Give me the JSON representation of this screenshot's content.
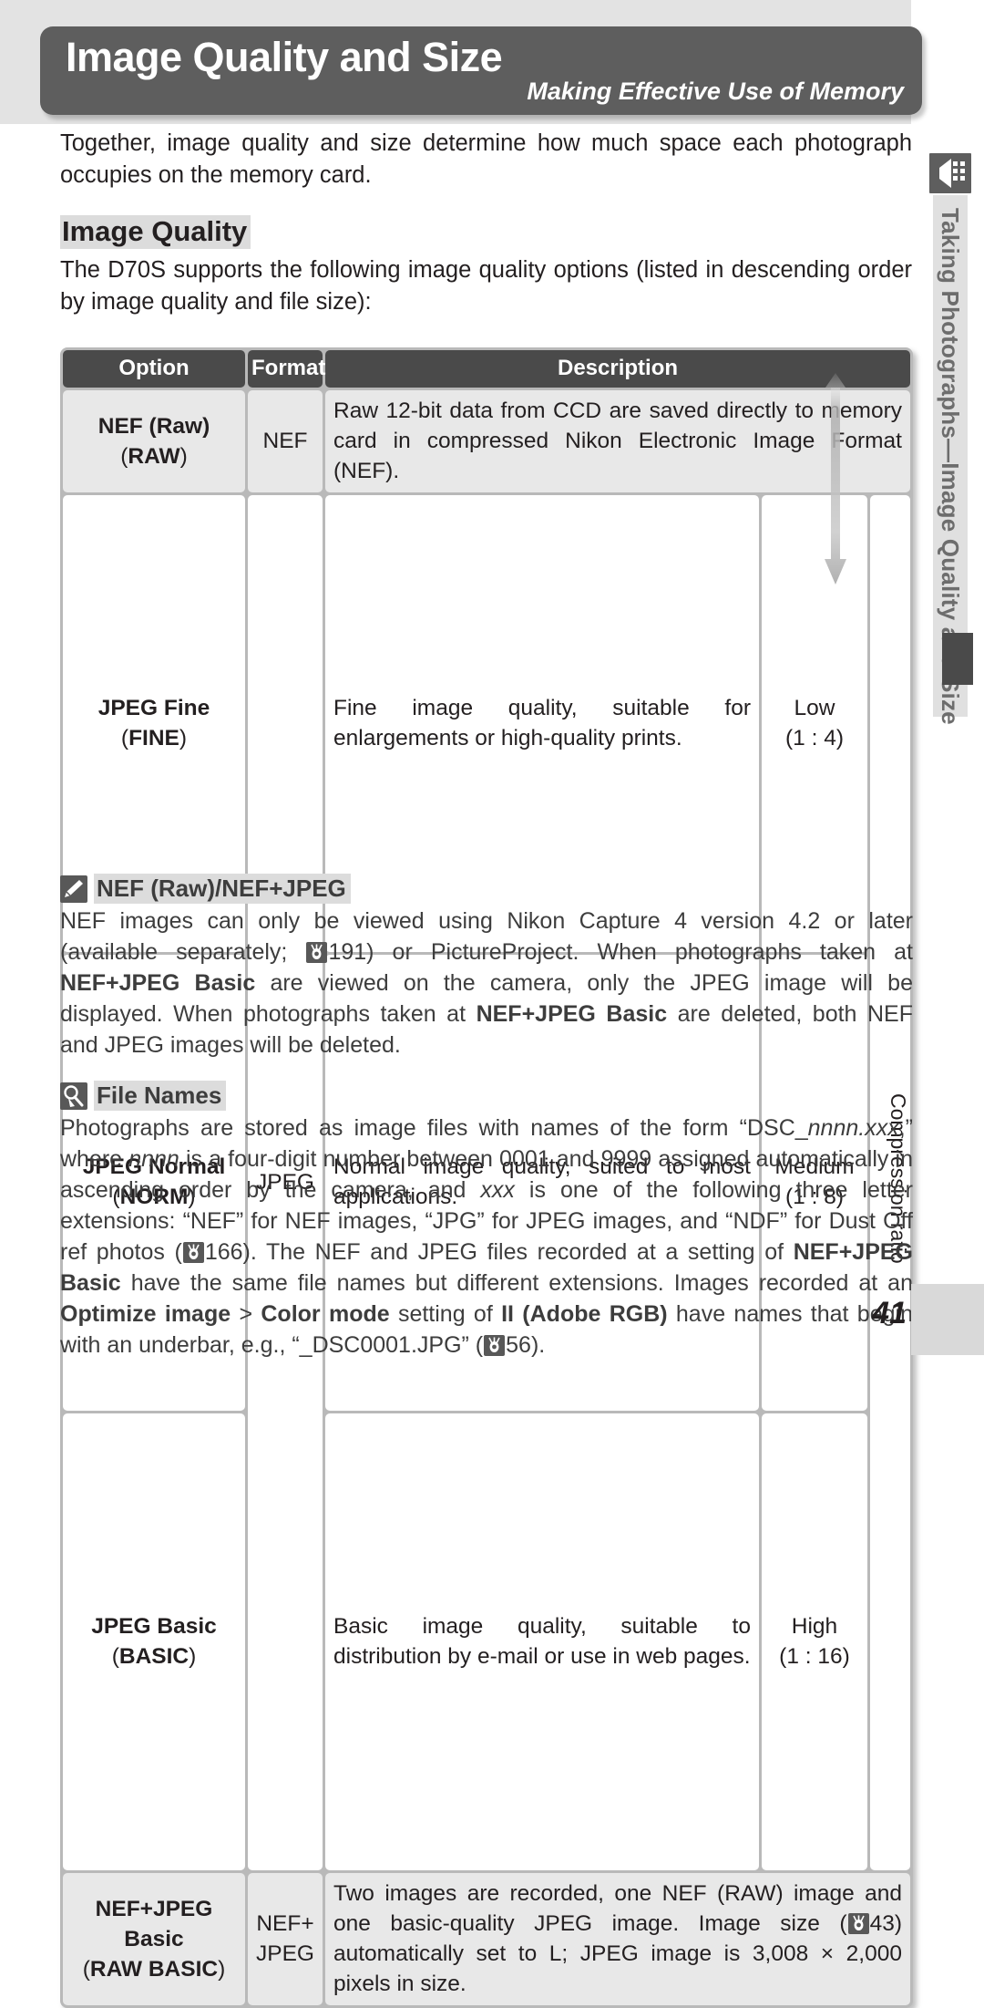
{
  "header": {
    "title": "Image Quality and Size",
    "subtitle": "Making Effective Use of Memory",
    "bg_color": "#5e5e5e"
  },
  "intro": {
    "paragraph": "Together, image quality and size determine how much space each photograph occupies on the memory card."
  },
  "section": {
    "heading": "Image Quality",
    "paragraph": "The D70S supports the following image quality options (listed in descending order by image quality and file size):"
  },
  "table": {
    "headers": {
      "option": "Option",
      "format": "Format",
      "description": "Description"
    },
    "compression_label": "Compression ratio",
    "rows": [
      {
        "option": "NEF (Raw)",
        "option_code": "(RAW)",
        "format": "NEF",
        "description": "Raw 12-bit data from CCD are saved directly to memory card in compressed Nikon Electronic Image Format (NEF).",
        "ratio": "",
        "ratio_value": ""
      },
      {
        "option": "JPEG Fine",
        "option_code": "(FINE)",
        "format": "JPEG",
        "description": "Fine image quality, suitable for enlargements or high-quality prints.",
        "ratio": "Low",
        "ratio_value": "(1 : 4)"
      },
      {
        "option": "JPEG Normal",
        "option_code": "(NORM)",
        "format": "",
        "description": "Normal image quality, suited to most applications.",
        "ratio": "Medium",
        "ratio_value": "(1 : 8)"
      },
      {
        "option": "JPEG Basic",
        "option_code": "(BASIC)",
        "format": "",
        "description": "Basic image quality, suitable to distribution by e-mail or use in web pages.",
        "ratio": "High",
        "ratio_value": "(1 : 16)"
      },
      {
        "option": "NEF+JPEG Basic",
        "option_code": "(RAW BASIC)",
        "format": "NEF+ JPEG",
        "description_pre": "Two images are recorded, one NEF (RAW) image and one basic-quality JPEG image.  Image size (",
        "description_page_ref": "43",
        "description_post": ") automatically set to L; JPEG image is 3,008 × 2,000 pixels in size.",
        "ratio": "",
        "ratio_value": ""
      }
    ]
  },
  "notes": [
    {
      "icon": "pencil-icon",
      "title": "NEF (Raw)/NEF+JPEG",
      "body_1": "NEF images can only be viewed using Nikon Capture 4 version 4.2 or later (available separately; ",
      "page_ref_1": "191",
      "body_2": ") or PictureProject.  When photographs taken at ",
      "bold_1": "NEF+JPEG Basic",
      "body_3": " are viewed on the camera, only the JPEG image will be displayed.  When photographs taken at ",
      "bold_2": "NEF+JPEG Basic",
      "body_4": " are deleted, both NEF and JPEG images will be deleted."
    },
    {
      "icon": "magnifier-icon",
      "title": "File Names",
      "body_1": "Photographs are stored as image files with names of the form “DSC_",
      "italic_1": "nnnn.xxx",
      "body_2": ",” where ",
      "italic_2": "nnnn",
      "body_3": " is a four-digit number between 0001 and 9999 assigned automatically in ascending order by the camera, and ",
      "italic_3": "xxx",
      "body_4": " is one of the following three letter extensions: “NEF” for NEF images, “JPG” for JPEG images, and “NDF” for Dust Off ref photos (",
      "page_ref_1": "166",
      "body_5": ").  The NEF and JPEG files recorded at a setting of ",
      "bold_1": "NEF+JPEG Basic",
      "body_6": " have the same file names but different extensions.  Images recorded at an ",
      "bold_2": "Optimize image",
      "body_7": " > ",
      "bold_3": "Color mode",
      "body_8": " setting of ",
      "bold_4": "II (Adobe RGB)",
      "body_9": " have names that begin with an underbar, e.g., “_DSC0001.JPG” (",
      "page_ref_2": "56",
      "body_10": ")."
    }
  ],
  "sidebar": {
    "icon": "flash-camera-icon",
    "label": "Taking Photographs—Image Quality and Size"
  },
  "footer": {
    "page_number": "41"
  }
}
